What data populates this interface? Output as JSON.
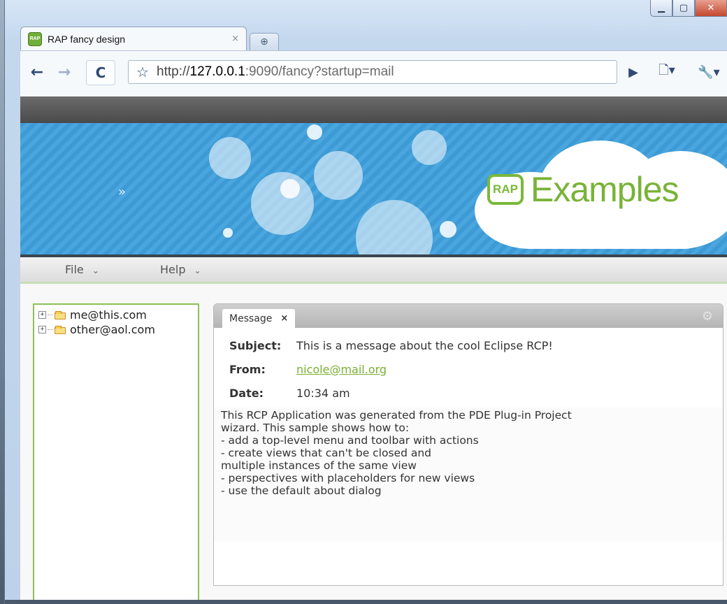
{
  "window": {
    "controls": [
      "minimize",
      "maximize",
      "close"
    ]
  },
  "tab": {
    "favicon_text": "RAP",
    "title": "RAP fancy design",
    "close_symbol": "×",
    "newtab_symbol": "⊕"
  },
  "toolbar": {
    "back_symbol": "←",
    "forward_symbol": "→",
    "reload_symbol": "C",
    "star_symbol": "☆",
    "url_scheme": "http://",
    "url_host": "127.0.0.1",
    "url_rest": ":9090/fancy?startup=mail",
    "play_symbol": "▶",
    "page_symbol": "🗋▾",
    "wrench_symbol": "🔧▾"
  },
  "banner": {
    "chevron": "»",
    "logo_mark": "RAP",
    "logo_word": "Examples",
    "accent_color": "#79b337",
    "bg_color": "#3d9ad4"
  },
  "menubar": {
    "file": "File",
    "help": "Help",
    "chevron": "⌄"
  },
  "tree": {
    "items": [
      {
        "label": "me@this.com"
      },
      {
        "label": "other@aol.com"
      }
    ]
  },
  "message_view": {
    "tab_label": "Message",
    "tab_close": "×",
    "gear": "⚙",
    "subject_label": "Subject:",
    "subject_value": "This is a message about the cool Eclipse RCP!",
    "from_label": "From:",
    "from_value": "nicole@mail.org",
    "date_label": "Date:",
    "date_value": "10:34 am",
    "body": "This RCP Application was generated from the PDE Plug-in Project\nwizard. This sample shows how to:\n- add a top-level menu and toolbar with actions\n- create views that can't be closed and\n  multiple instances of the same view\n- perspectives with placeholders for new views\n- use the default about dialog"
  }
}
